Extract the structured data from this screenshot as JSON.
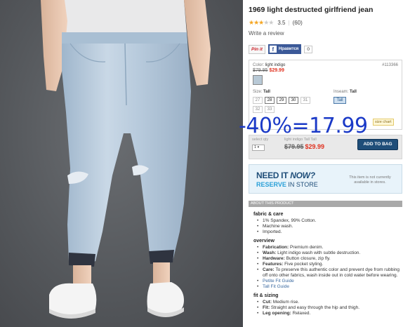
{
  "product": {
    "title": "1969 light destructed girlfriend jean",
    "rating_value": "3.5",
    "review_count": "(60)",
    "write_review": "Write a review"
  },
  "social": {
    "pin_label": "Pin it",
    "fb_label": "Нравится",
    "like_count": "0"
  },
  "selector": {
    "color_prefix": "Color:",
    "color_name": "light indigo",
    "sku": "#113366",
    "original_price": "$79.95",
    "sale_price": "$29.99",
    "size_prefix": "Size:",
    "size_value": "Tall",
    "inseam_prefix": "Inseam:",
    "inseam_value": "Tall",
    "inseam_option": "Tall",
    "sizes": [
      "27",
      "28",
      "29",
      "30",
      "31",
      "32",
      "33"
    ],
    "size_chart": "size chart"
  },
  "overlay": {
    "text": "-40%=17.99"
  },
  "bag": {
    "qty_label": "select qty",
    "qty_value": "1",
    "desc": "light indigo Tall Tall",
    "original_price": "$79.95",
    "sale_price": "$29.99",
    "add_label": "ADD TO BAG"
  },
  "reserve": {
    "need_a": "NEED IT ",
    "need_b": "NOW?",
    "reserve_a": "RESERVE",
    "reserve_b": " IN STORE",
    "note": "This item is not currently available in stores."
  },
  "about": {
    "header": "ABOUT THIS PRODUCT",
    "fabric_title": "fabric & care",
    "fabric": [
      "1% Spandex, 99% Cotton.",
      "Machine wash.",
      "Imported."
    ],
    "overview_title": "overview",
    "overview": [
      {
        "k": "Fabrication:",
        "v": " Premium denim."
      },
      {
        "k": "Wash:",
        "v": " Light indigo wash with subtle destruction."
      },
      {
        "k": "Hardware:",
        "v": " Button closure, zip fly."
      },
      {
        "k": "Features:",
        "v": " Five pocket styling."
      },
      {
        "k": "Care:",
        "v": " To preserve this authentic color and prevent dye from rubbing off onto other fabrics, wash inside out in cold water before wearing."
      }
    ],
    "links": [
      "Petite Fit Guide",
      "Tall Fit Guide"
    ],
    "fit_title": "fit & sizing",
    "fit": [
      {
        "k": "Cut:",
        "v": " Medium rise."
      },
      {
        "k": "Fit:",
        "v": " Straight and easy through the hip and thigh."
      },
      {
        "k": "Leg opening:",
        "v": " Relaxed."
      }
    ]
  },
  "colors": {
    "accent_blue": "#1f4e79",
    "sale_red": "#e0301e",
    "star": "#f5a623",
    "overlay_blue": "#1b3ac7"
  }
}
